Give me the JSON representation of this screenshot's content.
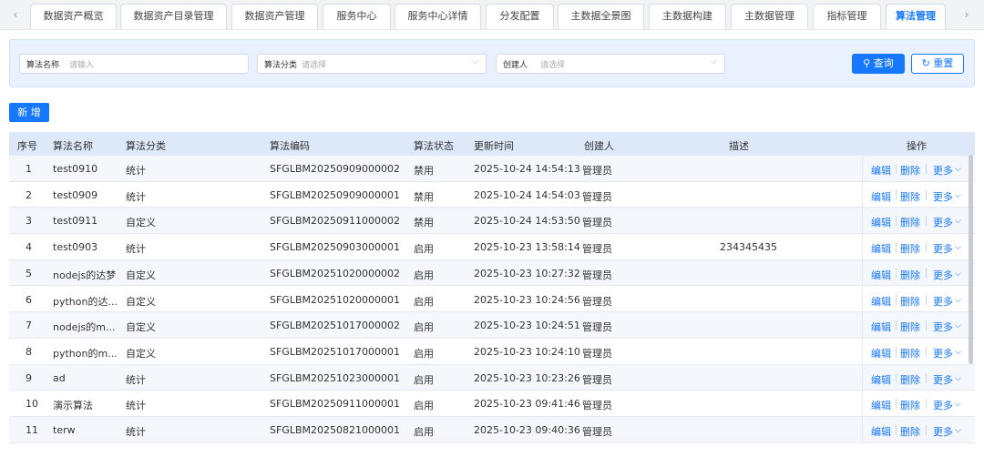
{
  "tabs": {
    "items": [
      "数据资产概览",
      "数据资产目录管理",
      "数据资产管理",
      "服务中心",
      "服务中心详情",
      "分发配置",
      "主数据全景图",
      "主数据构建",
      "主数据管理",
      "指标管理",
      "算法管理"
    ],
    "active_index": 10,
    "prev_icon": "chevron-left-icon",
    "next_icon": "chevron-right-icon"
  },
  "search": {
    "name_label": "算法名称",
    "name_placeholder": "请输入",
    "category_label": "算法分类",
    "category_placeholder": "请选择",
    "creator_label": "创建人",
    "creator_placeholder": "请选择",
    "query_label": "查询",
    "reset_label": "重置",
    "query_icon": "search-icon",
    "reset_icon": "refresh-icon"
  },
  "toolbar": {
    "add_label": "新 增"
  },
  "table": {
    "headers": {
      "index": "序号",
      "name": "算法名称",
      "category": "算法分类",
      "code": "算法编码",
      "status": "算法状态",
      "updated": "更新时间",
      "creator": "创建人",
      "desc": "描述",
      "ops": "操作"
    },
    "op_labels": {
      "edit": "编辑",
      "delete": "删除",
      "more": "更多"
    },
    "rows": [
      {
        "index": "1",
        "name": "test0910",
        "category": "统计",
        "code": "SFGLBM20250909000002",
        "status": "禁用",
        "updated": "2025-10-24 14:54:13",
        "creator": "管理员",
        "desc": ""
      },
      {
        "index": "2",
        "name": "test0909",
        "category": "统计",
        "code": "SFGLBM20250909000001",
        "status": "禁用",
        "updated": "2025-10-24 14:54:03",
        "creator": "管理员",
        "desc": ""
      },
      {
        "index": "3",
        "name": "test0911",
        "category": "自定义",
        "code": "SFGLBM20250911000002",
        "status": "禁用",
        "updated": "2025-10-24 14:53:50",
        "creator": "管理员",
        "desc": ""
      },
      {
        "index": "4",
        "name": "test0903",
        "category": "统计",
        "code": "SFGLBM20250903000001",
        "status": "启用",
        "updated": "2025-10-23 13:58:14",
        "creator": "管理员",
        "desc": "234345435"
      },
      {
        "index": "5",
        "name": "nodejs的达梦",
        "category": "自定义",
        "code": "SFGLBM20251020000002",
        "status": "启用",
        "updated": "2025-10-23 10:27:32",
        "creator": "管理员",
        "desc": ""
      },
      {
        "index": "6",
        "name": "python的达...",
        "category": "自定义",
        "code": "SFGLBM20251020000001",
        "status": "启用",
        "updated": "2025-10-23 10:24:56",
        "creator": "管理员",
        "desc": ""
      },
      {
        "index": "7",
        "name": "nodejs的m...",
        "category": "自定义",
        "code": "SFGLBM20251017000002",
        "status": "启用",
        "updated": "2025-10-23 10:24:51",
        "creator": "管理员",
        "desc": ""
      },
      {
        "index": "8",
        "name": "python的m...",
        "category": "自定义",
        "code": "SFGLBM20251017000001",
        "status": "启用",
        "updated": "2025-10-23 10:24:10",
        "creator": "管理员",
        "desc": ""
      },
      {
        "index": "9",
        "name": "ad",
        "category": "统计",
        "code": "SFGLBM20251023000001",
        "status": "启用",
        "updated": "2025-10-23 10:23:26",
        "creator": "管理员",
        "desc": ""
      },
      {
        "index": "10",
        "name": "演示算法",
        "category": "统计",
        "code": "SFGLBM20250911000001",
        "status": "启用",
        "updated": "2025-10-23 09:41:46",
        "creator": "管理员",
        "desc": ""
      },
      {
        "index": "11",
        "name": "terw",
        "category": "统计",
        "code": "SFGLBM20250821000001",
        "status": "启用",
        "updated": "2025-10-23 09:40:36",
        "creator": "管理员",
        "desc": ""
      }
    ]
  },
  "colors": {
    "accent": "#1677ff",
    "header_bg": "#dde9f8",
    "search_bg": "#e8f1fd"
  }
}
